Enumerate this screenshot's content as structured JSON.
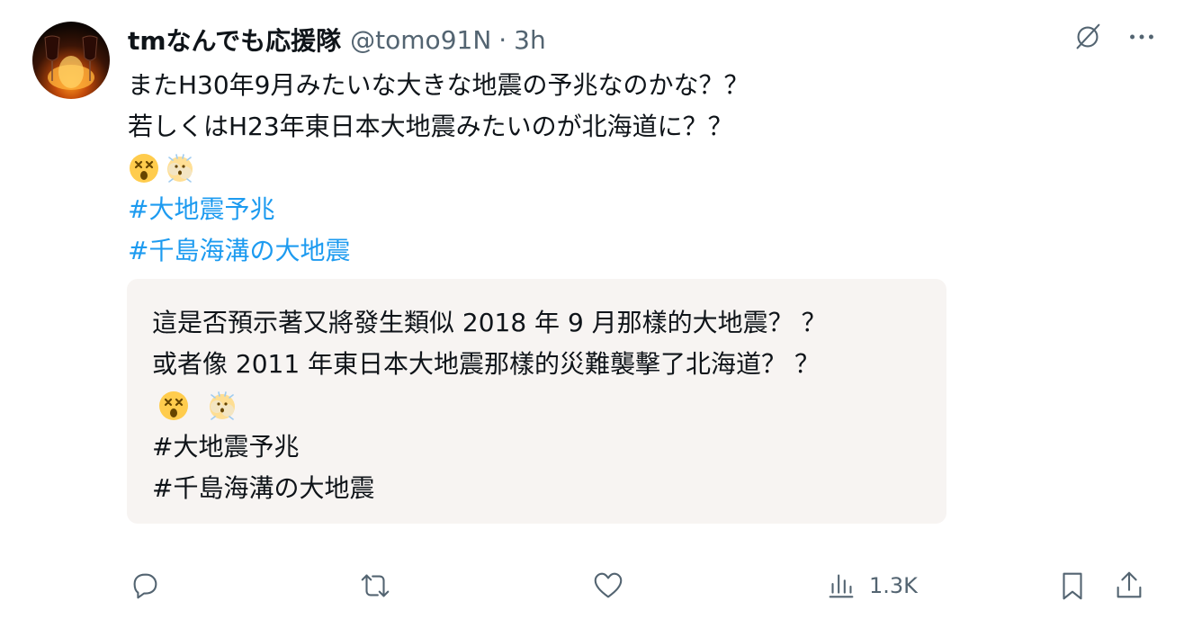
{
  "tweet": {
    "author_name": "tmなんでも応援隊",
    "handle": "@tomo91N",
    "separator": "·",
    "time": "3h",
    "lines": [
      "またH30年9月みたいな大きな地震の予兆なのかな？？",
      "若しくはH23年東日本大地震みたいのが北海道に？？"
    ],
    "emojis": [
      "dizzy-face-emoji",
      "face-in-clouds-emoji"
    ],
    "hashtags": [
      "#大地震予兆",
      "#千島海溝の大地震"
    ]
  },
  "translation": {
    "lines": [
      "這是否預示著又將發生類似 2018 年 9 月那樣的大地震？ ？",
      "或者像 2011 年東日本大地震那樣的災難襲擊了北海道？ ？"
    ],
    "hashtags": [
      "#大地震予兆",
      "#千島海溝の大地震"
    ]
  },
  "actions": {
    "reply_icon": "reply-icon",
    "retweet_icon": "retweet-icon",
    "like_icon": "heart-icon",
    "views_icon": "views-icon",
    "views_count": "1.3K",
    "bookmark_icon": "bookmark-icon",
    "share_icon": "share-icon"
  },
  "colors": {
    "text": "#0f1419",
    "muted": "#536471",
    "hashtag": "#1d9bf0",
    "quote_bg": "#f7f4f2"
  }
}
